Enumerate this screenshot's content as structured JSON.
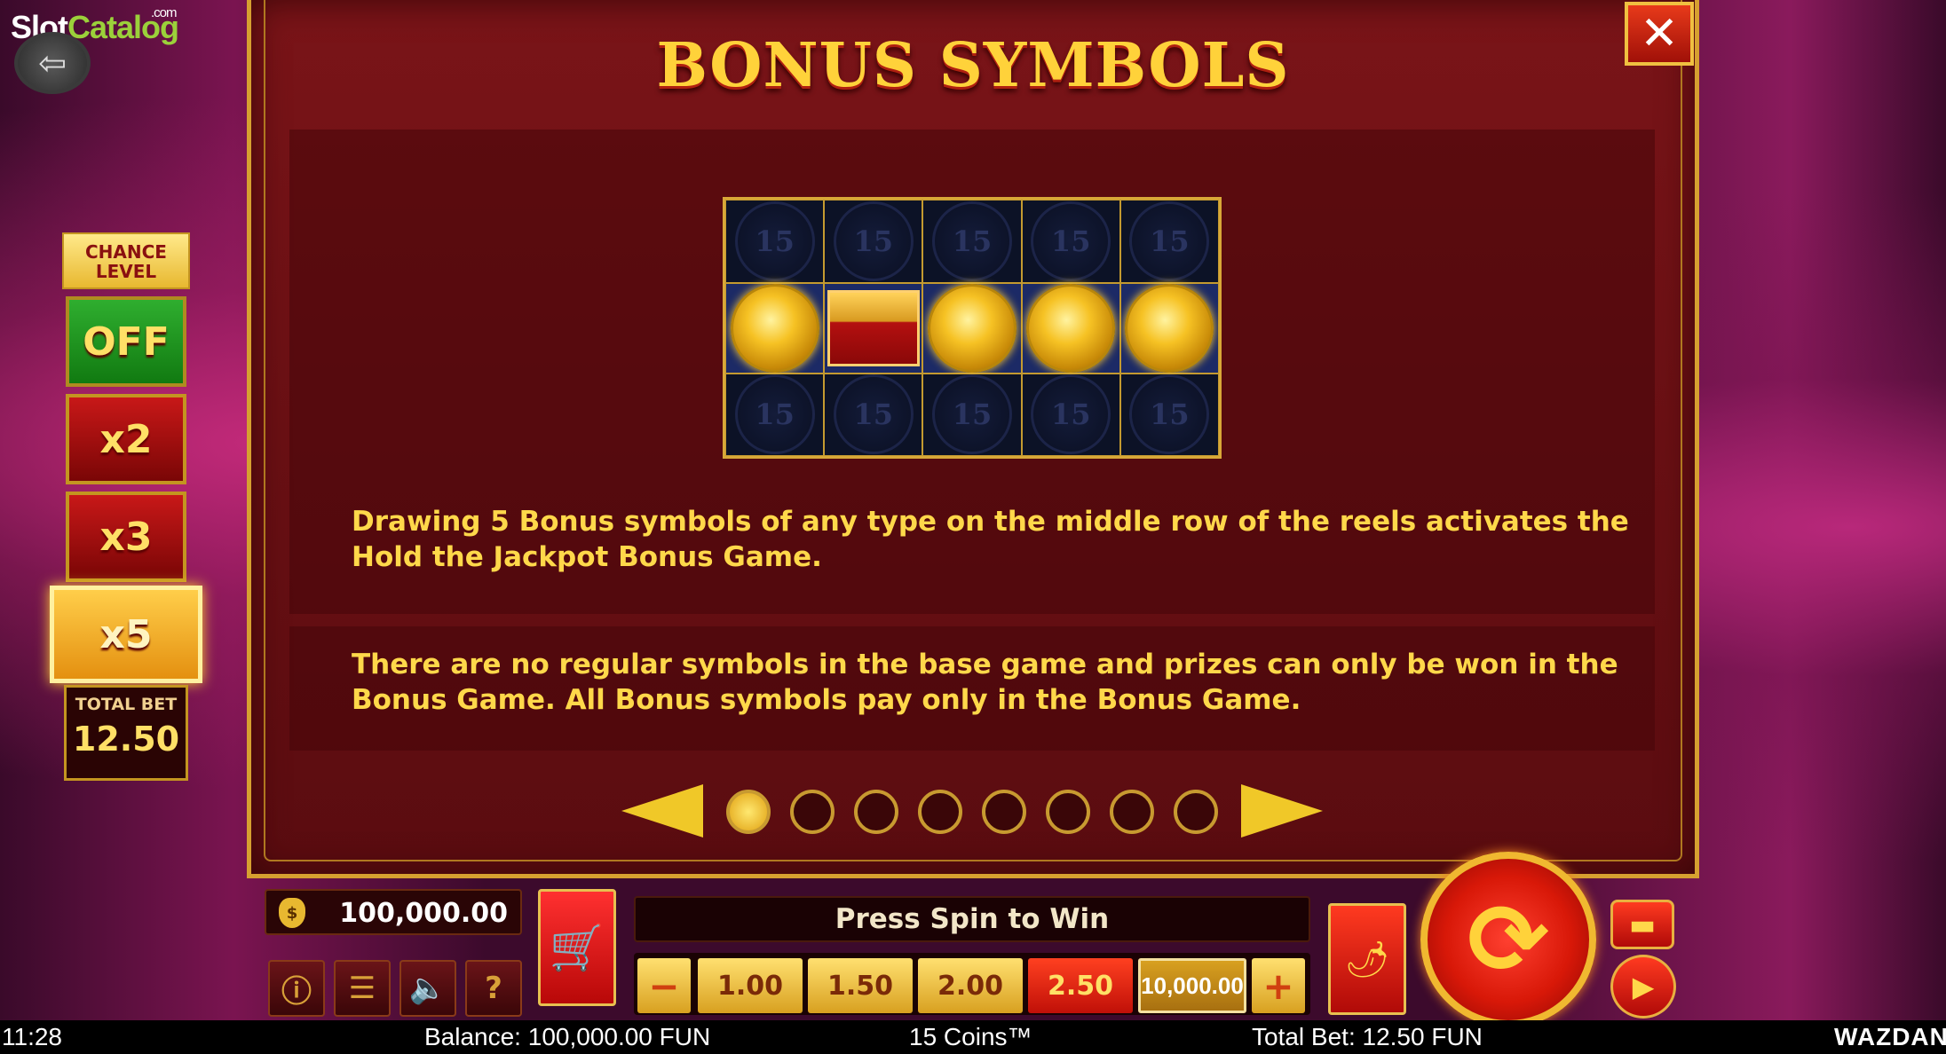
{
  "logo": {
    "main": "Slot",
    "accent": "Catalog",
    "suffix": ".com"
  },
  "chance": {
    "title_line1": "CHANCE",
    "title_line2": "LEVEL",
    "options": [
      "OFF",
      "x2",
      "x3",
      "x5"
    ],
    "selected": "x5",
    "total_bet_label": "TOTAL BET",
    "total_bet_value": "12.50"
  },
  "dialog": {
    "title": "BONUS SYMBOLS",
    "close_label": "✕",
    "reel_bg_symbol": "15",
    "text1": "Drawing 5 Bonus symbols of any type on the middle row of the reels activates the Hold the Jackpot Bonus Game.",
    "text2": "There are no regular symbols in the base game and prizes can only be won in the Bonus Game. All Bonus symbols pay only in the Bonus Game.",
    "page_count": 8,
    "current_page": 1
  },
  "bar": {
    "balance": "100,000.00",
    "message": "Press Spin to Win",
    "bets": [
      "1.00",
      "1.50",
      "2.00",
      "2.50"
    ],
    "selected_bet": "2.50",
    "max_bet": "10,000.00",
    "minus": "−",
    "plus": "+",
    "icons": [
      "info-icon",
      "menu-icon",
      "sound-icon",
      "help-icon"
    ]
  },
  "footer": {
    "time": "11:28",
    "balance": "Balance: 100,000.00 FUN",
    "game": "15 Coins™",
    "total_bet": "Total Bet: 12.50 FUN",
    "brand": "WAZDAN"
  },
  "colors": {
    "accent_gold": "#ffd84a",
    "panel_red": "#7a1418",
    "selected_red": "#c01008"
  }
}
